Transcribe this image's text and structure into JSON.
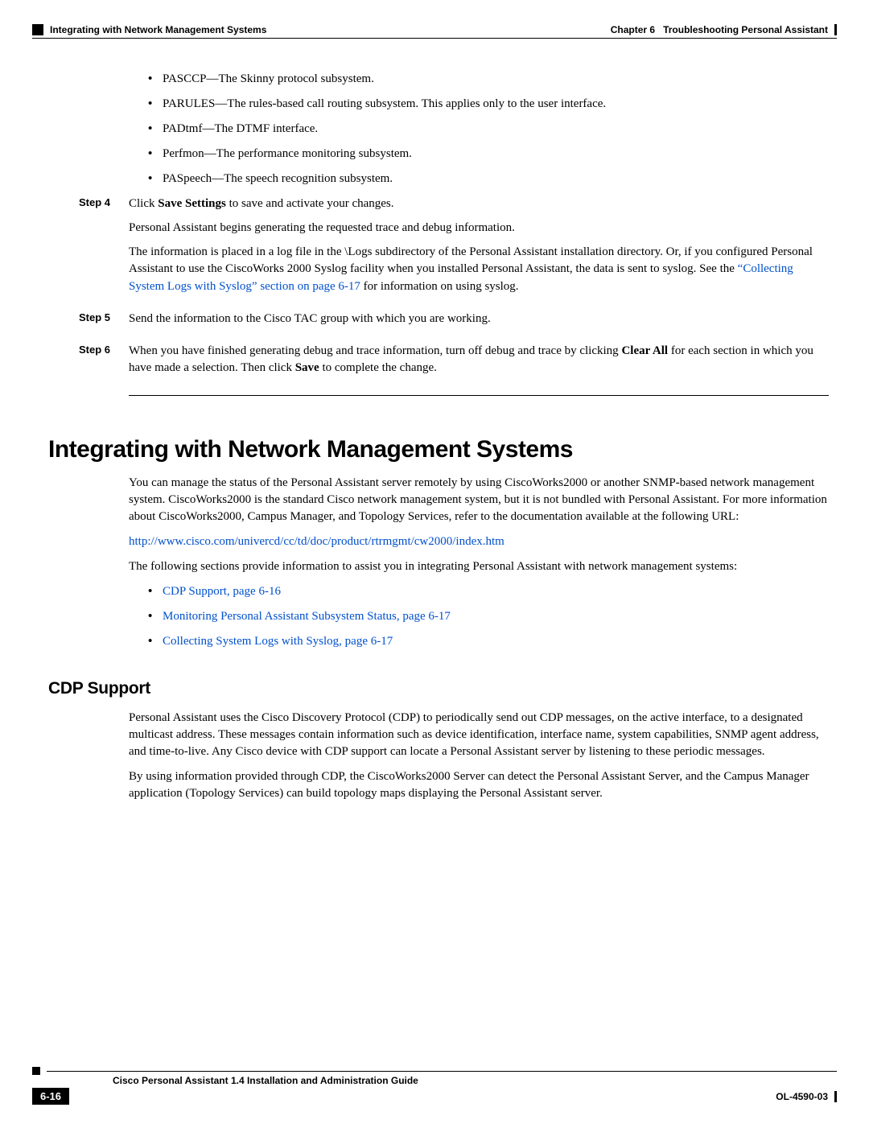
{
  "header": {
    "section_title": "Integrating with Network Management Systems",
    "chapter_label": "Chapter 6",
    "chapter_title": "Troubleshooting Personal Assistant"
  },
  "bullets_top": [
    "PASCCP—The Skinny protocol subsystem.",
    "PARULES—The rules-based call routing subsystem. This applies only to the user interface.",
    "PADtmf—The DTMF interface.",
    "Perfmon—The performance monitoring subsystem.",
    "PASpeech—The speech recognition subsystem."
  ],
  "step4": {
    "label": "Step 4",
    "line1_a": "Click ",
    "line1_b": "Save Settings",
    "line1_c": " to save and activate your changes.",
    "line2": "Personal Assistant begins generating the requested trace and debug information.",
    "line3_a": "The information is placed in a log file in the \\Logs subdirectory of the Personal Assistant installation directory. Or, if you configured Personal Assistant to use the CiscoWorks 2000 Syslog facility when you installed Personal Assistant, the data is sent to syslog. See the ",
    "line3_link": "“Collecting System Logs with Syslog” section on page 6-17",
    "line3_b": " for information on using syslog."
  },
  "step5": {
    "label": "Step 5",
    "text": "Send the information to the Cisco TAC group with which you are working."
  },
  "step6": {
    "label": "Step 6",
    "a": "When you have finished generating debug and trace information, turn off debug and trace by clicking ",
    "b1": "Clear All",
    "c": " for each section in which you have made a selection. Then click ",
    "b2": "Save",
    "d": " to complete the change."
  },
  "section": {
    "title": "Integrating with Network Management Systems",
    "para1": "You can manage the status of the Personal Assistant server remotely by using CiscoWorks2000 or another SNMP-based network management system. CiscoWorks2000 is the standard Cisco network management system, but it is not bundled with Personal Assistant. For more information about CiscoWorks2000, Campus Manager, and Topology Services, refer to the documentation available at the following URL:",
    "url": "http://www.cisco.com/univercd/cc/td/doc/product/rtrmgmt/cw2000/index.htm",
    "para2": "The following sections provide information to assist you in integrating Personal Assistant with network management systems:",
    "toc": [
      "CDP Support, page 6-16",
      "Monitoring Personal Assistant Subsystem Status, page 6-17",
      "Collecting System Logs with Syslog, page 6-17"
    ]
  },
  "cdp": {
    "title": "CDP Support",
    "para1": "Personal Assistant uses the Cisco Discovery Protocol (CDP) to periodically send out CDP messages, on the active interface, to a designated multicast address. These messages contain information such as device identification, interface name, system capabilities, SNMP agent address, and time-to-live. Any Cisco device with CDP support can locate a Personal Assistant server by listening to these periodic messages.",
    "para2": "By using information provided through CDP, the CiscoWorks2000 Server can detect the Personal Assistant Server, and the Campus Manager application (Topology Services) can build topology maps displaying the Personal Assistant server."
  },
  "footer": {
    "guide": "Cisco Personal Assistant 1.4 Installation and Administration Guide",
    "page": "6-16",
    "docid": "OL-4590-03"
  }
}
